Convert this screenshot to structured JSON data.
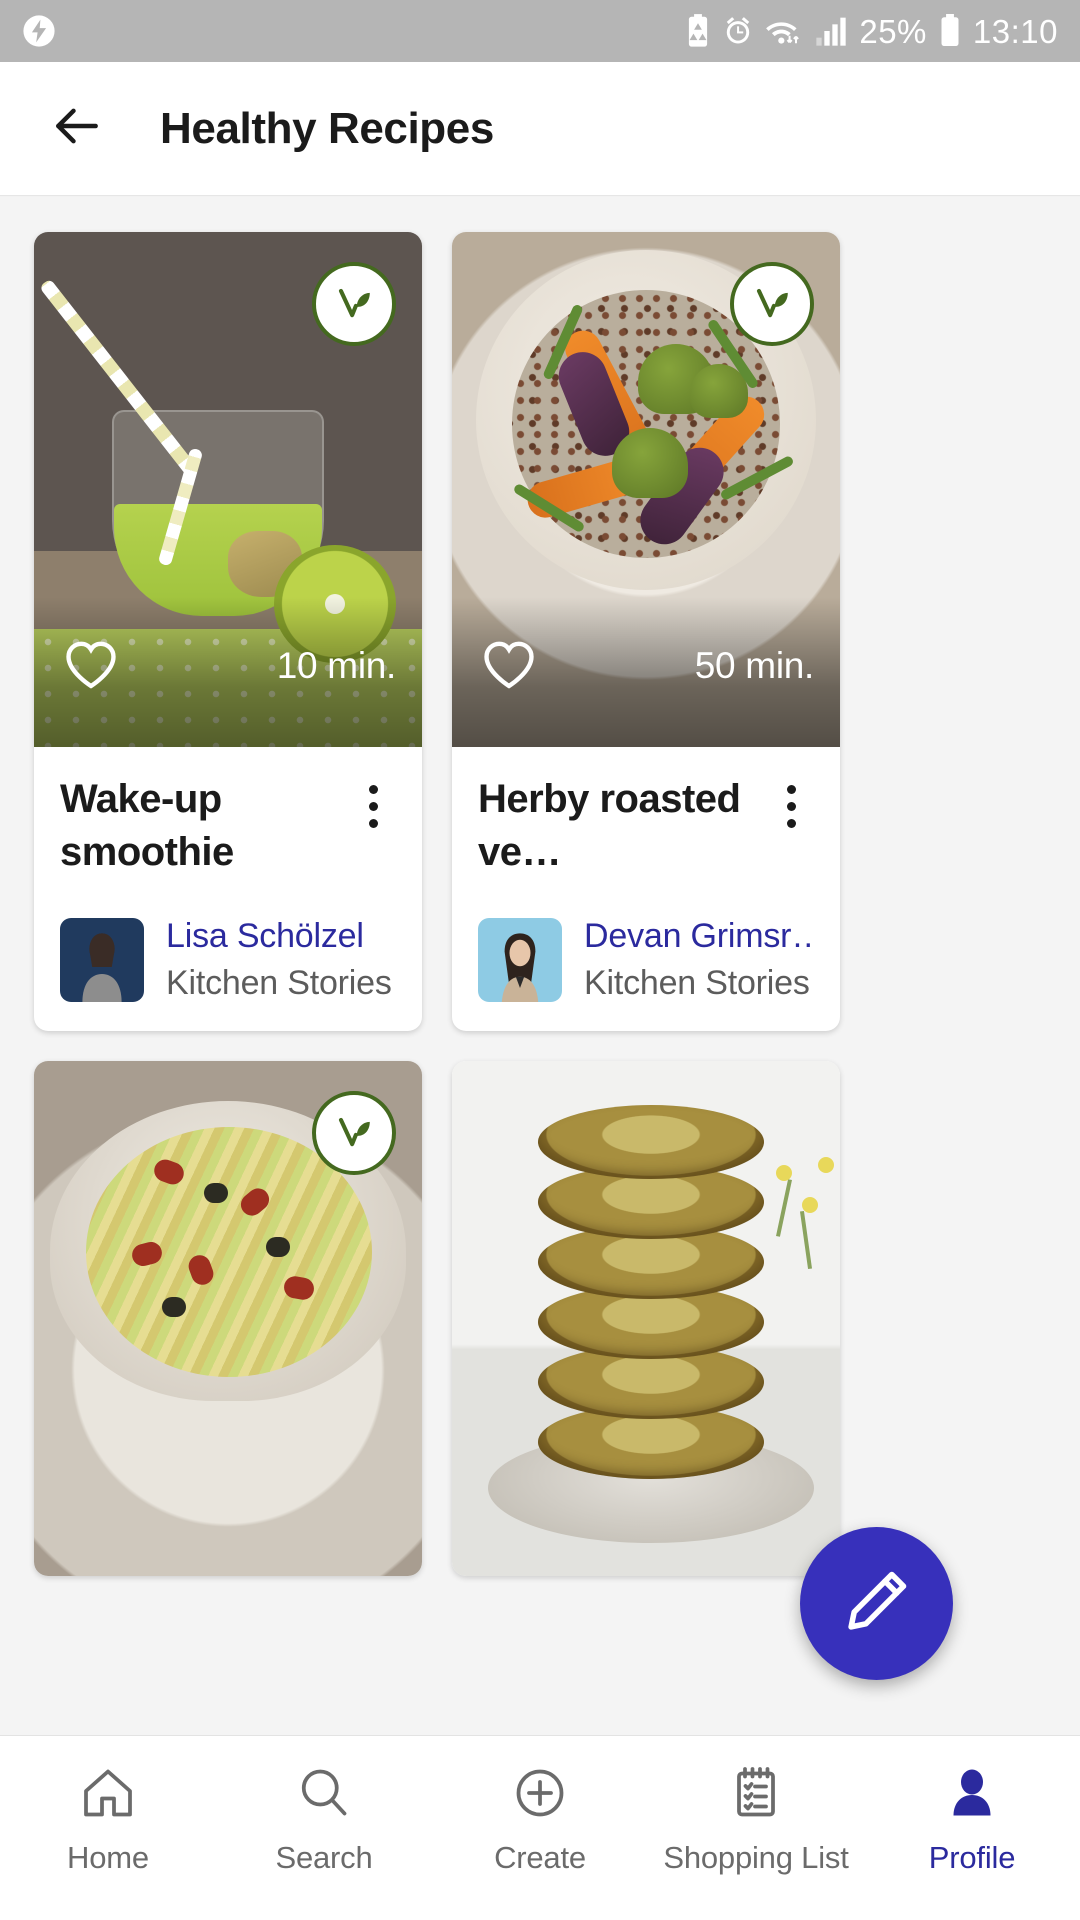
{
  "statusbar": {
    "icons": [
      "battery-saver-icon",
      "alarm-icon",
      "wifi-icon",
      "signal-icon",
      "battery-icon"
    ],
    "battery_percent": "25%",
    "time": "13:10"
  },
  "appbar": {
    "back_icon": "arrow-left-icon",
    "title": "Healthy Recipes"
  },
  "colors": {
    "accent": "#2b2a9e",
    "fab": "#3730bb",
    "badge_green": "#44691f",
    "statusbar_bg": "#b5b5b5",
    "page_bg": "#f4f4f4",
    "nav_inactive": "#6b6b6b"
  },
  "cards": [
    {
      "title": "Wake-up smoothie",
      "time": "10 min.",
      "vegetarian": true,
      "badge_icon": "vegetarian-leaf-icon",
      "favorite_icon": "heart-outline-icon",
      "menu_icon": "more-vertical-icon",
      "author": {
        "name": "Lisa Schölzel",
        "brand": "Kitchen Stories"
      },
      "photo": "green-smoothie-glass-with-kiwi"
    },
    {
      "title": "Herby roasted ve…",
      "time": "50 min.",
      "vegetarian": true,
      "badge_icon": "vegetarian-leaf-icon",
      "favorite_icon": "heart-outline-icon",
      "menu_icon": "more-vertical-icon",
      "author": {
        "name": "Devan Grimsr…",
        "brand": "Kitchen Stories"
      },
      "photo": "roasted-vegetables-quinoa-bowl"
    },
    {
      "title": "",
      "time": "",
      "vegetarian": true,
      "badge_icon": "vegetarian-leaf-icon",
      "favorite_icon": "heart-outline-icon",
      "menu_icon": "more-vertical-icon",
      "author": {
        "name": "",
        "brand": ""
      },
      "photo": "zucchini-noodles-sundried-tomato"
    },
    {
      "title": "",
      "time": "",
      "vegetarian": false,
      "badge_icon": "",
      "favorite_icon": "heart-outline-icon",
      "menu_icon": "more-vertical-icon",
      "author": {
        "name": "",
        "brand": ""
      },
      "photo": "zucchini-fritters-stack"
    }
  ],
  "fab": {
    "icon": "pencil-edit-icon",
    "label": ""
  },
  "bottomnav": {
    "items": [
      {
        "label": "Home",
        "icon": "home-icon",
        "active": false
      },
      {
        "label": "Search",
        "icon": "search-icon",
        "active": false
      },
      {
        "label": "Create",
        "icon": "plus-circle-icon",
        "active": false
      },
      {
        "label": "Shopping List",
        "icon": "clipboard-list-icon",
        "active": false
      },
      {
        "label": "Profile",
        "icon": "person-icon",
        "active": true
      }
    ]
  }
}
